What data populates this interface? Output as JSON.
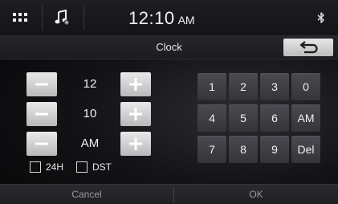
{
  "status_bar": {
    "time": "12:10",
    "meridiem": "AM",
    "icons": {
      "menu": "grid-icon",
      "source": "music-note-icon",
      "bluetooth": "bluetooth-icon"
    }
  },
  "screen": {
    "title": "Clock",
    "back_icon": "back-arrow-icon"
  },
  "setters": {
    "hour": {
      "value": "12"
    },
    "minute": {
      "value": "10"
    },
    "meridiem": {
      "value": "AM"
    }
  },
  "options": {
    "h24": {
      "label": "24H",
      "checked": false
    },
    "dst": {
      "label": "DST",
      "checked": false
    }
  },
  "keypad": {
    "keys": [
      "1",
      "2",
      "3",
      "0",
      "4",
      "5",
      "6",
      "AM",
      "7",
      "8",
      "9",
      "Del"
    ]
  },
  "footer": {
    "cancel_label": "Cancel",
    "ok_label": "OK"
  }
}
